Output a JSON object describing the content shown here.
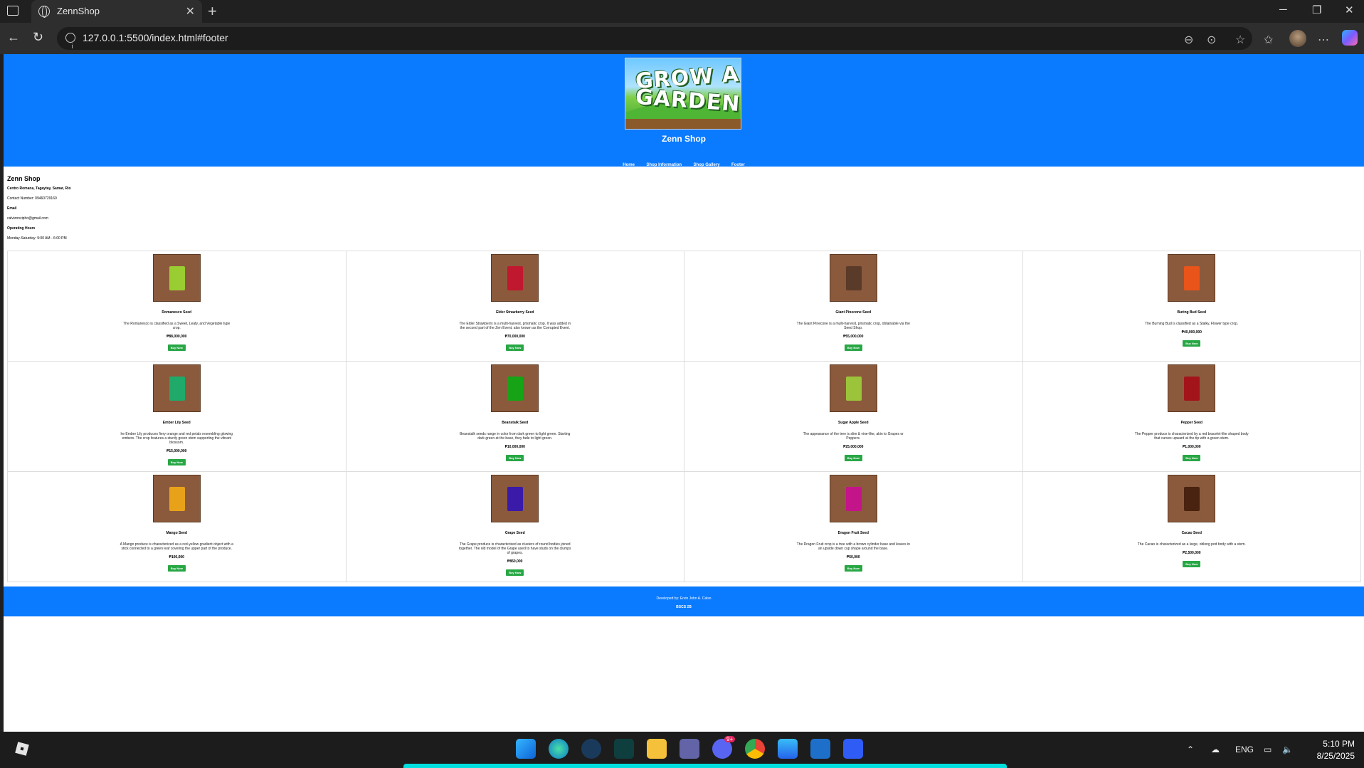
{
  "browser": {
    "tab_title": "ZennShop",
    "url": "127.0.0.1:5500/index.html#footer"
  },
  "site": {
    "name": "Zenn Shop",
    "logo_text_line1": "GROW A",
    "logo_text_line2": "GARDEN",
    "nav": [
      "Home",
      "Shop Information",
      "Shop Gallery",
      "Footer"
    ]
  },
  "info": {
    "heading": "Zenn Shop",
    "address_label": "Centro Romana, Tagaytay, Samar, Rio",
    "contact": "Contact Number: 09460729160",
    "email_label": "Email",
    "email": "calvizonzipho@gmail.com",
    "hours_label": "Operating Hours",
    "hours": "Monday-Saturday: 9:00 AM - 6:00 PM"
  },
  "products": [
    {
      "name": "Romanesco Seed",
      "desc": "The Romanesco is classified as a Sweet, Leafy, and Vegetable type crop.",
      "price": "₱88,000,000",
      "color": "#9acd32",
      "buy": "Buy Now"
    },
    {
      "name": "Elder Strawberry Seed",
      "desc": "The Elder Strawberry is a multi-harvest, prismatic crop. It was added in the second part of the Zen Event, also known as the Corrupted Event.",
      "price": "₱70,000,000",
      "color": "#c0182e",
      "buy": "Buy Now"
    },
    {
      "name": "Giant Pinecone Seed",
      "desc": "The Giant Pinecone is a multi-harvest, prismatic crop, obtainable via the Seed Shop.",
      "price": "₱55,000,000",
      "color": "#5a3a28",
      "buy": "Buy Now"
    },
    {
      "name": "Buring Bud Seed",
      "desc": "The Burning Bud is classified as a Stalky, Flower type crop.",
      "price": "₱40,000,000",
      "color": "#e8541a",
      "buy": "Buy Now"
    },
    {
      "name": "Ember Lily Seed",
      "desc": "he Ember Lily produces fiery orange and red petals resembling glowing embers. The crop features a sturdy green stem supporting the vibrant blossom.",
      "price": "₱15,000,000",
      "color": "#1faa6a",
      "buy": "Buy Now"
    },
    {
      "name": "Beanstalk Seed",
      "desc": "Beanstalk seeds range in color from dark green to light green. Starting dark green at the base, they fade to light green.",
      "price": "₱10,000,000",
      "color": "#16a316",
      "buy": "Buy Now"
    },
    {
      "name": "Sugar Apple Seed",
      "desc": "The appearance of the tree is slim & vine-like, akin to Grapes or Peppers.",
      "price": "₱25,000,000",
      "color": "#9cc43a",
      "buy": "Buy Now"
    },
    {
      "name": "Pepper Seed",
      "desc": "The Pepper produce is characterized by a red bracelet-like shaped body that curves upward at the tip with a green stem.",
      "price": "₱1,000,000",
      "color": "#a3141a",
      "buy": "Buy Now"
    },
    {
      "name": "Mango Seed",
      "desc": "A Mango produce is characterized as a red-yellow gradient object with a stick connected to a green leaf covering the upper part of the produce.",
      "price": "₱100,000",
      "color": "#e8a21a",
      "buy": "Buy Now"
    },
    {
      "name": "Grape Seed",
      "desc": "The Grape produce is characterized as clusters of round bodies joined together. The old model of the Grape used to have studs on the clumps of grapes.",
      "price": "₱850,000",
      "color": "#3a1aa8",
      "buy": "Buy Now"
    },
    {
      "name": "Dragon Fruit Seed",
      "desc": "The Dragon Fruit crop is a tree with a brown cylinder base and leaves in an upside down cup shape around the base.",
      "price": "₱50,000",
      "color": "#c4148a",
      "buy": "Buy Now"
    },
    {
      "name": "Cacao Seed",
      "desc": "The Cacao is characterized as a large, oblong pod body with a stem.",
      "price": "₱2,500,000",
      "color": "#4a2210",
      "buy": "Buy Now"
    }
  ],
  "footer": {
    "line1": "Developed by: Ervin John A. Calso",
    "line2": "BSCS 2B"
  },
  "taskbar": {
    "lang": "ENG",
    "time": "5:10 PM",
    "date": "8/25/2025",
    "badge": "9+"
  }
}
